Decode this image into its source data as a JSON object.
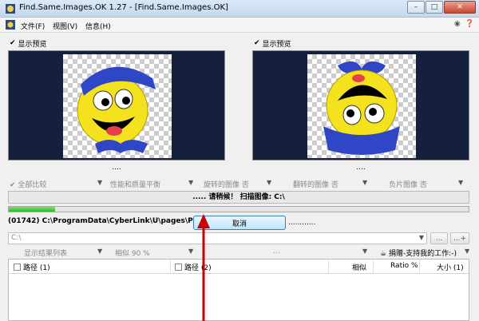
{
  "window": {
    "title": "Find.Same.Images.OK 1.27 - [Find.Same.Images.OK]"
  },
  "menu": {
    "items": [
      "文件(F)",
      "视图(V)",
      "信息(H)"
    ]
  },
  "preview": {
    "left_label": "显示预览",
    "right_label": "显示预览",
    "left_dots": "....",
    "right_dots": "...."
  },
  "options": {
    "compare_all": "全部比较",
    "performance": "性能和质量平衡",
    "rotated": "旋转的图像 否",
    "flipped": "翻转的图像 否",
    "negative": "负片图像 否"
  },
  "status": {
    "text": "..... 请稍候！ 扫描图像: C:\\",
    "progress": 0.1
  },
  "scan": {
    "current_path": "(01742) C:\\ProgramData\\CyberLink\\U\\pages\\Pres",
    "cancel_label": "取消",
    "trailing_dots": "............"
  },
  "folder": {
    "value": "C:\\",
    "browse_label": "...",
    "add_label": "...+"
  },
  "controls": {
    "show_results": "显示结果列表",
    "similarity": "相似 90 %",
    "ellipsis": "...",
    "donate": "捐赠-支持我的工作:-)"
  },
  "table": {
    "columns": [
      "路径 (1)",
      "路径 (2)",
      "相似",
      "Ratio %",
      "大小 (1)"
    ]
  },
  "colors": {
    "preview_bg": "#14203c",
    "progress_fill": "#2fb82a",
    "arrow": "#cc0000"
  }
}
